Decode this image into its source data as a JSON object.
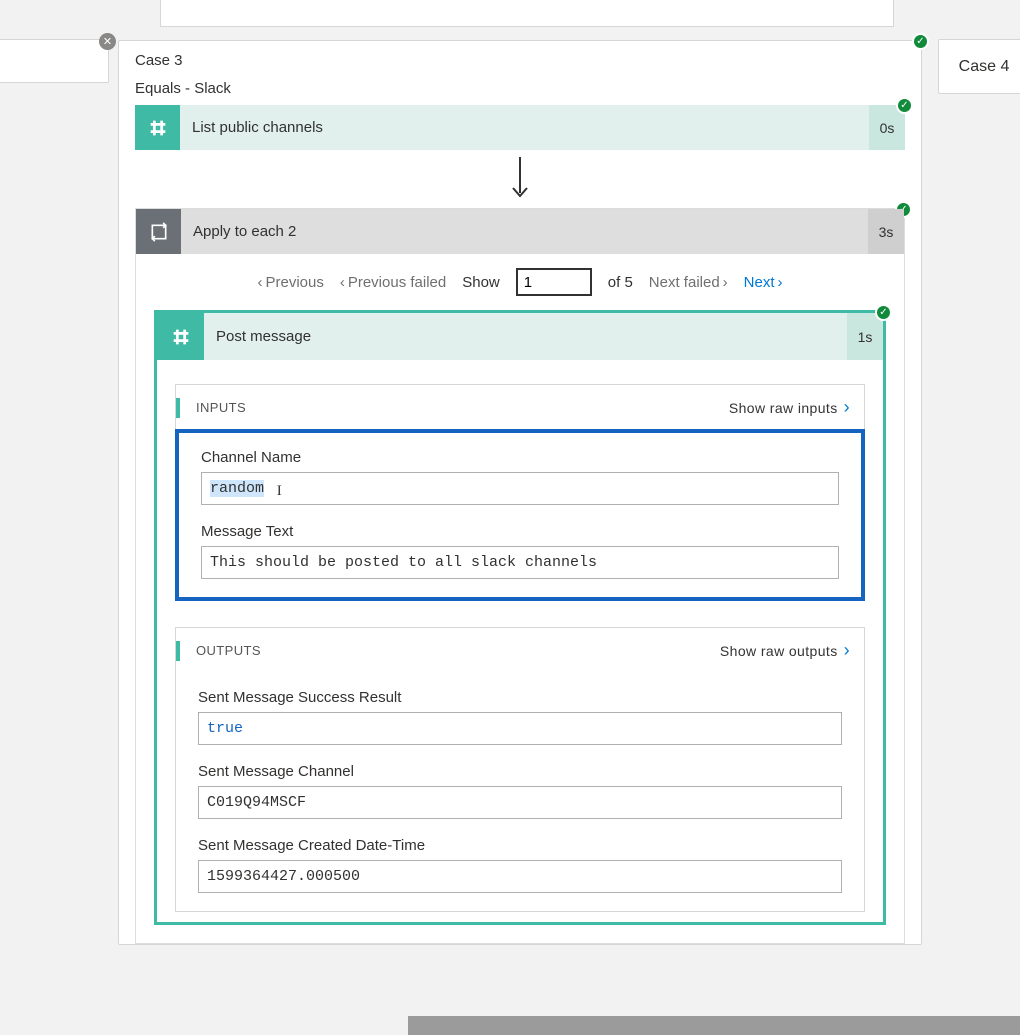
{
  "case_left": {
    "title": ""
  },
  "case_right": {
    "title": "Case 4"
  },
  "main": {
    "title": "Case 3",
    "subtitle": "Equals - Slack",
    "action1": {
      "title": "List public channels",
      "time": "0s"
    },
    "loop": {
      "title": "Apply to each 2",
      "time": "3s",
      "pager": {
        "prev": "Previous",
        "prev_failed": "Previous failed",
        "show_label": "Show",
        "current": "1",
        "of_total": "of 5",
        "next_failed": "Next failed",
        "next": "Next"
      },
      "post": {
        "title": "Post message",
        "time": "1s",
        "inputs": {
          "header": "INPUTS",
          "show_raw": "Show raw inputs",
          "channel_name_label": "Channel Name",
          "channel_name_value": "random",
          "message_text_label": "Message Text",
          "message_text_value": "This should be posted to all slack channels"
        },
        "outputs": {
          "header": "OUTPUTS",
          "show_raw": "Show raw outputs",
          "success_label": "Sent Message Success Result",
          "success_value": "true",
          "channel_label": "Sent Message Channel",
          "channel_value": "C019Q94MSCF",
          "created_label": "Sent Message Created Date-Time",
          "created_value": "1599364427.000500"
        }
      }
    }
  }
}
